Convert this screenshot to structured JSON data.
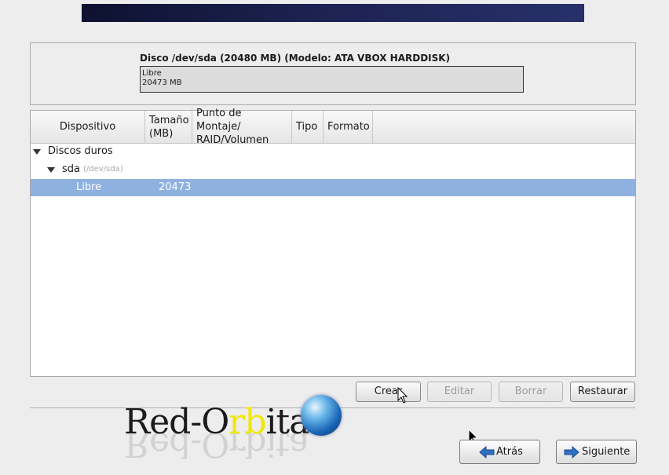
{
  "disk": {
    "title": "Disco /dev/sda (20480 MB) (Modelo: ATA VBOX HARDDISK)",
    "bar_label": "Libre",
    "bar_size": "20473 MB"
  },
  "table": {
    "columns": [
      "Dispositivo",
      "Tamaño\n(MB)",
      "Punto de Montaje/\n RAID/Volumen",
      "Tipo",
      "Formato"
    ],
    "rows": [
      {
        "device": "Discos duros",
        "size": "",
        "hint": ""
      },
      {
        "device": "sda",
        "size": "",
        "hint": "(/dev/sda)"
      },
      {
        "device": "Libre",
        "size": "20473",
        "hint": "",
        "selected": true
      }
    ]
  },
  "actions": {
    "create": "Crear",
    "edit": "Editar",
    "delete": "Borrar",
    "reset": "Restaurar"
  },
  "logo": {
    "prefix": "Red-O",
    "highlight": "rb",
    "suffix": "ita"
  },
  "nav": {
    "back": "Atrás",
    "next": "Siguiente"
  },
  "icons": {
    "expand": "triangle-down-icon",
    "back": "arrow-left-icon",
    "next": "arrow-right-icon",
    "globe": "globe-icon"
  },
  "colors": {
    "selection": "#8eb1e0",
    "banner": "#1c2250",
    "arrow": "#2f6fc4"
  }
}
